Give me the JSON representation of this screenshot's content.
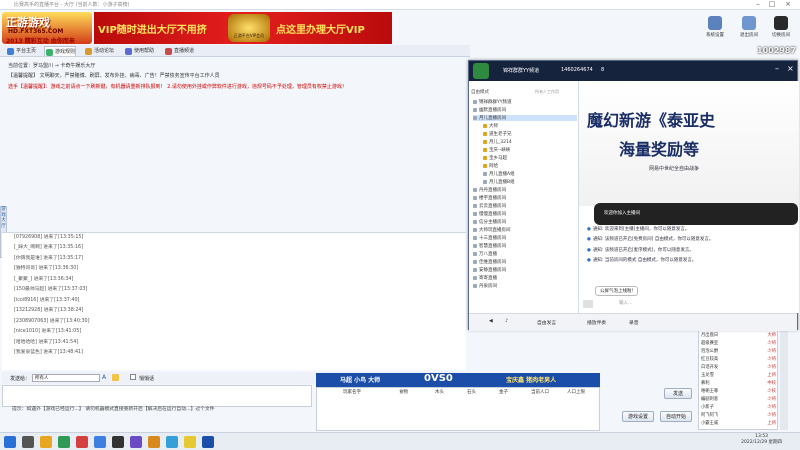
{
  "window": {
    "title": "比赛高手的直播平台 - 大厅 (当前人数：小游子高榜)",
    "watermark": "1002987"
  },
  "banner": {
    "logo_line1": "正游游戏",
    "logo_line2": "HD.FXT365.COM",
    "logo_line3": "2013 精彩互动 由你而来",
    "vip_left": "VIP随时进出大厅不用挤",
    "vip_right": "点这里办理大厅VIP",
    "emblem_caption": "正游平台VIP会员"
  },
  "toolbar": {
    "system_settings": "系统设置",
    "leave_room": "退出房间",
    "switch_room": "切换房间"
  },
  "nav": {
    "items": [
      {
        "label": "平台主页",
        "color": "#3f7fd8"
      },
      {
        "label": "游戏规则",
        "color": "#3bb36a"
      },
      {
        "label": "活动论坛",
        "color": "#d99a2b"
      },
      {
        "label": "使用帮助",
        "color": "#5c6bd3"
      },
      {
        "label": "直播频道",
        "color": "#c94a4a"
      }
    ]
  },
  "info": {
    "location": "当前位置：罗马盟川 → 卡奇牛娱乐大厅",
    "notice1": "【温馨提醒】 文明聊天，严禁赌博、刷屏、发布外挂、病毒、广告！严禁债务宣传平台工作人员",
    "notice2": "选手【温馨提醒】：游戏之前请点一下刷新键，有机器请重新排队报到！ 2.请勿使用外挂或作弊软件进行游戏，违规号码不予处理，管理员有权禁止游戏！"
  },
  "side_tab": "游戏大厅",
  "chat_log": [
    "[07926908] 进来了[13:35:15]",
    "[_踩大_啊啊] 进来了[13:35:16]",
    "[你猜我是谁] 进来了[13:35:17]",
    "[独特哥哥] 进来了[13:36:30]",
    "[_聚聚_] 进来了[13:36:34]",
    "[150最帅马超] 进来了[13:37:03]",
    "[icoi8916] 进来了[13:37:40]",
    "[13212928] 进来了[13:38:24]",
    "[2308907063] 进来了[13:40:30]",
    "[nice1010] 进来了[13:41:05]",
    "[哈哈哈哈] 进来了[13:41:54]",
    "[我爱泉蓝色] 进来了[13:48:41]"
  ],
  "send_bar": {
    "label": "发送给：",
    "target": "所有人",
    "private_label": "悄悄话"
  },
  "tip": "提示：如遇外【游戏已经运行...】 请勿机器模式直接重新开启【解决后在运行自动...】过个文件",
  "buttons": {
    "send": "发送",
    "game_settings": "游戏设置",
    "auto_start": "自动开始"
  },
  "vs_panel": {
    "left_player": "马超 小鸟 大师",
    "score": "0VS0",
    "right_player": "宝庆鑫 猪肉老男人",
    "columns": [
      "玩家名字",
      "食物",
      "木头",
      "石头",
      "金子",
      "当前人口",
      "人口上限"
    ]
  },
  "yy": {
    "channel_name": "锦祥群群YY频道",
    "channel_id": "1460264674",
    "count": "8",
    "tree_header_left": "自由模式",
    "tree_header_right": "所有人工作用",
    "tree": [
      "锦祥群群YY频道",
      "幽默直播房间",
      "月儿直播房间",
      "大师",
      "道生老子兄",
      "月儿_3214",
      "宝庆--峡峡",
      "宝乡马超",
      "阿哈",
      "月儿直播A组",
      "月儿直播B组",
      "丹丹直播房间",
      "楼宇直播房间",
      "云云直播房间",
      "慢慢直播房间",
      "信分主播房间",
      "大师玩直播房间",
      "十三直播房间",
      "智慧直播房间",
      "万八直播",
      "佳维直播房间",
      "安静直播房间",
      "寄寄直播",
      "丹泉房间"
    ],
    "promo_line1": "魔幻新游《泰亚史",
    "promo_line2": "海量奖励等",
    "promo_small": "网易中世纪全自由战争",
    "messages": [
      "通知: 欢迎来到[主播]主播间，你可以随意发言。",
      "通知: 该频道已开启[免费房间] 自由模式，你可以随意发言。",
      "通知: 该频道已开启[麦序模式]，你可以随意发言。",
      "通知: 当前房间的模式 自由模式，你可以随意发言。"
    ],
    "bubble": "公屏气泡上线啦!",
    "input_placeholder": "输入…",
    "bottom_free": "自由发言",
    "bottom_mic": "播放伴奏",
    "bottom_record": "录音"
  },
  "toast": "欢迎你加入主播间",
  "user_list": [
    {
      "name": "月出盘日",
      "rank": "大师"
    },
    {
      "name": "超级赛亚",
      "rank": "少将"
    },
    {
      "name": "泡泡公爵",
      "rank": "少将"
    },
    {
      "name": "红豆较高",
      "rank": "少将"
    },
    {
      "name": "白话开发",
      "rank": "少将"
    },
    {
      "name": "玉龙雪",
      "rank": "上将"
    },
    {
      "name": "慕利",
      "rank": "中校"
    },
    {
      "name": "唯朝王尊",
      "rank": "少校"
    },
    {
      "name": "编剧刺客",
      "rank": "少将"
    },
    {
      "name": "小新子",
      "rank": "少将"
    },
    {
      "name": "阿飞阿飞",
      "rank": "少将"
    },
    {
      "name": "小霸王威",
      "rank": "上将"
    }
  ],
  "clock": {
    "time": "13:53",
    "date": "2022/12/29 星期四"
  }
}
